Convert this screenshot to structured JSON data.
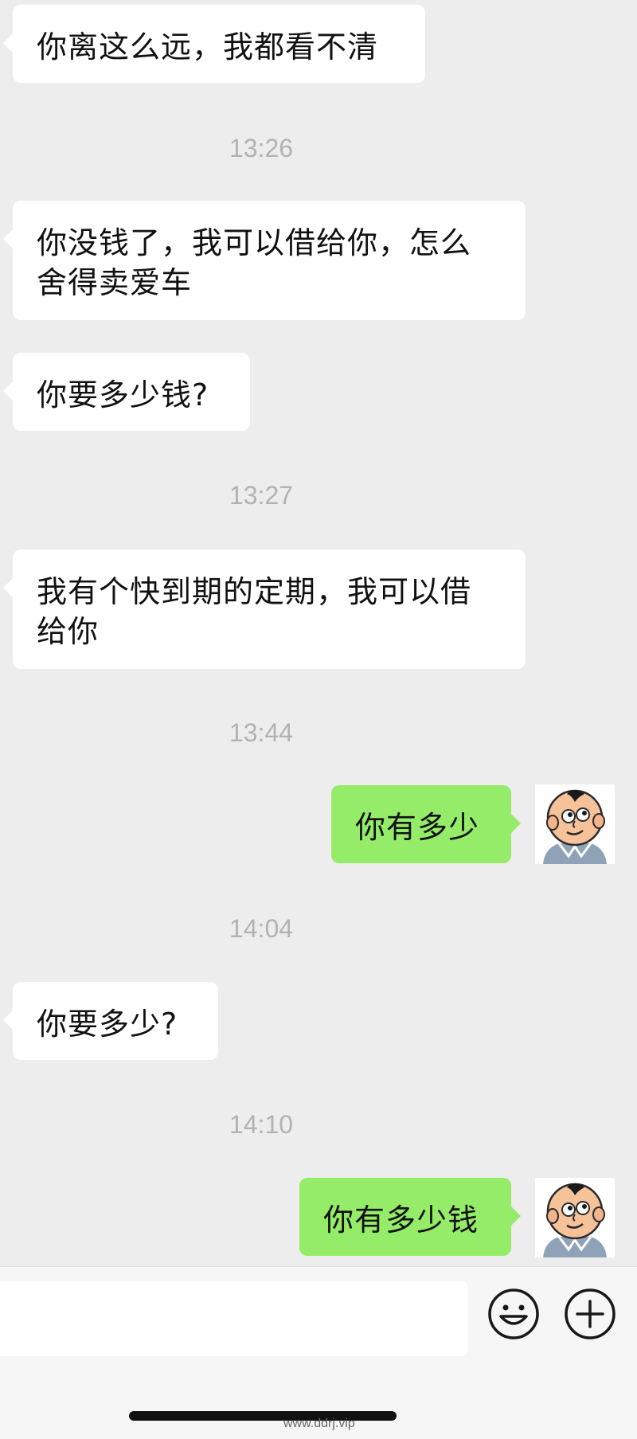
{
  "messages": [
    {
      "type": "in",
      "text": "你离这么远，我都看不清"
    },
    {
      "type": "time",
      "text": "13:26"
    },
    {
      "type": "in",
      "text": "你没钱了，我可以借给你，怎么舍得卖爱车"
    },
    {
      "type": "in",
      "text": "你要多少钱?"
    },
    {
      "type": "time",
      "text": "13:27"
    },
    {
      "type": "in",
      "text": "我有个快到期的定期，我可以借给你"
    },
    {
      "type": "time",
      "text": "13:44"
    },
    {
      "type": "out",
      "text": "你有多少"
    },
    {
      "type": "time",
      "text": "14:04"
    },
    {
      "type": "in",
      "text": "你要多少?"
    },
    {
      "type": "time",
      "text": "14:10"
    },
    {
      "type": "out",
      "text": "你有多少钱"
    }
  ],
  "input": {
    "value": "",
    "placeholder": ""
  },
  "icons": {
    "emoji": "emoji-smiley-icon",
    "add": "plus-circle-icon",
    "avatar": "cartoon-baby-avatar"
  },
  "colors": {
    "background": "#ededed",
    "incoming_bubble": "#ffffff",
    "outgoing_bubble": "#95ec69",
    "timestamp": "#b2b2b2"
  },
  "watermark": "www.ddrj.vip"
}
